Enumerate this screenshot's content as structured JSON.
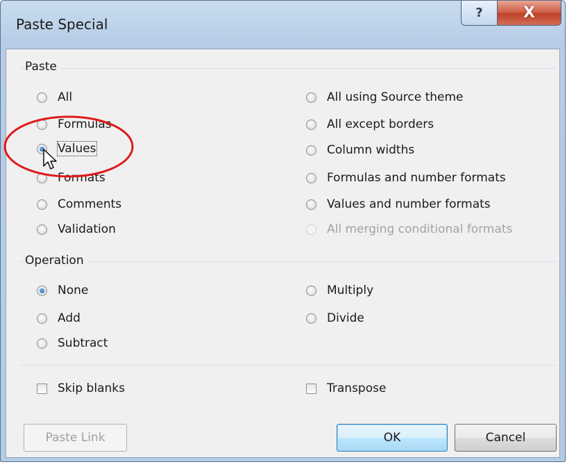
{
  "window": {
    "title": "Paste Special",
    "help_label": "?",
    "close_label": "X"
  },
  "paste_group": {
    "label": "Paste",
    "left_options": [
      {
        "label": "All",
        "checked": false,
        "enabled": true
      },
      {
        "label": "Formulas",
        "checked": false,
        "enabled": true
      },
      {
        "label": "Values",
        "checked": true,
        "enabled": true
      },
      {
        "label": "Formats",
        "checked": false,
        "enabled": true
      },
      {
        "label": "Comments",
        "checked": false,
        "enabled": true
      },
      {
        "label": "Validation",
        "checked": false,
        "enabled": true
      }
    ],
    "right_options": [
      {
        "label": "All using Source theme",
        "checked": false,
        "enabled": true
      },
      {
        "label": "All except borders",
        "checked": false,
        "enabled": true
      },
      {
        "label": "Column widths",
        "checked": false,
        "enabled": true
      },
      {
        "label": "Formulas and number formats",
        "checked": false,
        "enabled": true
      },
      {
        "label": "Values and number formats",
        "checked": false,
        "enabled": true
      },
      {
        "label": "All merging conditional formats",
        "checked": false,
        "enabled": false
      }
    ]
  },
  "operation_group": {
    "label": "Operation",
    "left_options": [
      {
        "label": "None",
        "checked": true
      },
      {
        "label": "Add",
        "checked": false
      },
      {
        "label": "Subtract",
        "checked": false
      }
    ],
    "right_options": [
      {
        "label": "Multiply",
        "checked": false
      },
      {
        "label": "Divide",
        "checked": false
      }
    ]
  },
  "checkboxes": {
    "skip_blanks": {
      "label": "Skip blanks",
      "checked": false
    },
    "transpose": {
      "label": "Transpose",
      "checked": false
    }
  },
  "buttons": {
    "paste_link": "Paste Link",
    "ok": "OK",
    "cancel": "Cancel"
  },
  "annotation": {
    "highlight_color": "#e0191b"
  }
}
